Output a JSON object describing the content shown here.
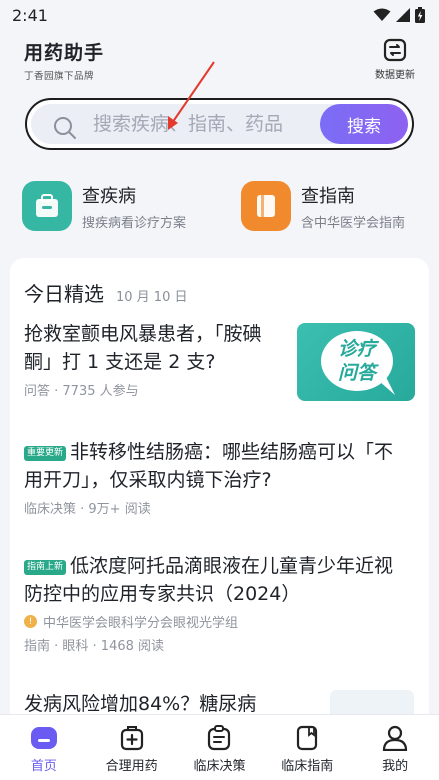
{
  "status_bar": {
    "time": "2:41"
  },
  "header": {
    "brand_title": "用药助手",
    "brand_subtitle": "丁香园旗下品牌",
    "update_label": "数据更新"
  },
  "search": {
    "placeholder": "搜索疾病、指南、药品",
    "button_label": "搜索"
  },
  "quick_entries": [
    {
      "title": "查疾病",
      "desc": "搜疾病看诊疗方案",
      "icon": "medical-kit-icon",
      "color": "#35b7a3"
    },
    {
      "title": "查指南",
      "desc": "含中华医学会指南",
      "icon": "book-icon",
      "color": "#f08a2c"
    }
  ],
  "feed": {
    "title": "今日精选",
    "date": "10 月 10 日",
    "articles": [
      {
        "title": "抢救室颤电风暴患者，「胺碘酮」打 1 支还是 2 支?",
        "meta": "问答 · 7735 人参与",
        "thumb_text": "诊疗问答"
      },
      {
        "badge": "重要更新",
        "title": "非转移性结肠癌：哪些结肠癌可以「不用开刀」，仅采取内镜下治疗?",
        "meta": "临床决策 · 9万+ 阅读"
      },
      {
        "badge": "指南上新",
        "title": "低浓度阿托品滴眼液在儿童青少年近视防控中的应用专家共识（2024）",
        "source": "中华医学会眼科学分会眼视光学组",
        "meta": "指南 · 眼科 · 1468 阅读"
      },
      {
        "title": "发病风险增加84%？糖尿病"
      }
    ]
  },
  "bottom_nav": [
    {
      "label": "首页",
      "icon": "home-icon",
      "active": true
    },
    {
      "label": "合理用药",
      "icon": "medicine-box-icon",
      "active": false
    },
    {
      "label": "临床决策",
      "icon": "clipboard-icon",
      "active": false
    },
    {
      "label": "临床指南",
      "icon": "guide-book-icon",
      "active": false
    },
    {
      "label": "我的",
      "icon": "user-icon",
      "active": false
    }
  ],
  "colors": {
    "accent": "#7b6df6",
    "teal": "#35b7a3",
    "orange": "#f08a2c",
    "badge_green": "#2aa98a"
  }
}
